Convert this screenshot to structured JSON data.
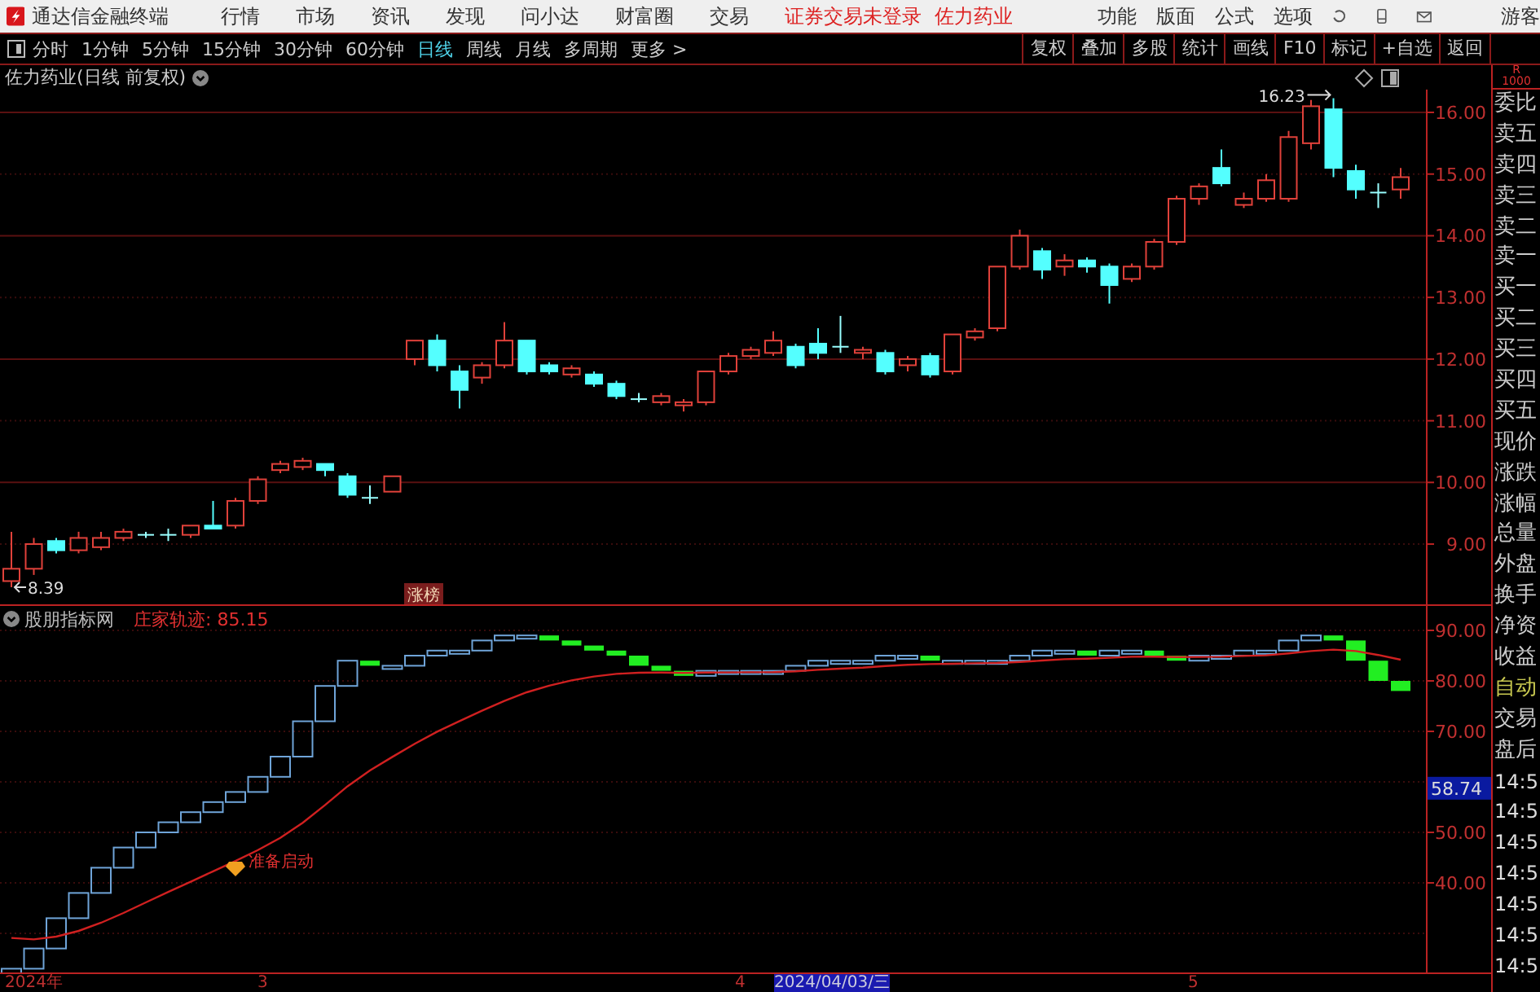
{
  "menubar": {
    "app_title": "通达信金融终端",
    "menus": [
      "行情",
      "市场",
      "资讯",
      "发现",
      "问小达",
      "财富圈",
      "交易"
    ],
    "login_status": "证券交易未登录",
    "stock_name": "佐力药业",
    "tools": [
      "功能",
      "版面",
      "公式",
      "选项"
    ],
    "user": "游客"
  },
  "toolbar": {
    "periods": [
      {
        "label": "分时",
        "selected": false
      },
      {
        "label": "1分钟",
        "selected": false
      },
      {
        "label": "5分钟",
        "selected": false
      },
      {
        "label": "15分钟",
        "selected": false
      },
      {
        "label": "30分钟",
        "selected": false
      },
      {
        "label": "60分钟",
        "selected": false
      },
      {
        "label": "日线",
        "selected": true
      },
      {
        "label": "周线",
        "selected": false
      },
      {
        "label": "月线",
        "selected": false
      },
      {
        "label": "多周期",
        "selected": false
      },
      {
        "label": "更多 >",
        "selected": false
      }
    ],
    "buttons": [
      "复权",
      "叠加",
      "多股",
      "统计",
      "画线",
      "F10",
      "标记",
      "+自选",
      "返回"
    ]
  },
  "price_chart": {
    "title": "佐力药业(日线 前复权)",
    "yticks": [
      "16.00",
      "15.00",
      "14.00",
      "13.00",
      "12.00",
      "11.00",
      "10.00",
      "9.00"
    ],
    "high_label": "16.23",
    "low_label": "8.39",
    "tag": "涨榜"
  },
  "indicator": {
    "source": "股朋指标网",
    "reading": "庄家轨迹: 85.15",
    "signal": "准备启动",
    "yticks": [
      "90.00",
      "80.00",
      "70.00",
      "50.00",
      "40.00"
    ],
    "cursor_value": "58.74"
  },
  "date_axis": [
    {
      "label": "2024年",
      "selected": false
    },
    {
      "label": "3",
      "selected": false
    },
    {
      "label": "4",
      "selected": false
    },
    {
      "label": "2024/04/03/三",
      "selected": true
    },
    {
      "label": "5",
      "selected": false
    }
  ],
  "quote_panel": {
    "header": [
      "R",
      "1000"
    ],
    "items": [
      {
        "text": "委比",
        "kind": "label"
      },
      {
        "text": "卖五",
        "kind": "label"
      },
      {
        "text": "卖四",
        "kind": "label"
      },
      {
        "text": "卖三",
        "kind": "label"
      },
      {
        "text": "卖二",
        "kind": "label"
      },
      {
        "text": "卖一",
        "kind": "label"
      },
      {
        "text": "买一",
        "kind": "label"
      },
      {
        "text": "买二",
        "kind": "label"
      },
      {
        "text": "买三",
        "kind": "label"
      },
      {
        "text": "买四",
        "kind": "label"
      },
      {
        "text": "买五",
        "kind": "label"
      },
      {
        "text": "现价",
        "kind": "label"
      },
      {
        "text": "涨跌",
        "kind": "label"
      },
      {
        "text": "涨幅",
        "kind": "label"
      },
      {
        "text": "总量",
        "kind": "label"
      },
      {
        "text": "外盘",
        "kind": "label"
      },
      {
        "text": "换手",
        "kind": "label"
      },
      {
        "text": "净资",
        "kind": "label"
      },
      {
        "text": "收益",
        "kind": "label"
      },
      {
        "text": "自动",
        "kind": "mode"
      },
      {
        "text": "交易",
        "kind": "label"
      },
      {
        "text": "盘后",
        "kind": "label"
      },
      {
        "text": "14:5",
        "kind": "time"
      },
      {
        "text": "14:5",
        "kind": "time"
      },
      {
        "text": "14:5",
        "kind": "time"
      },
      {
        "text": "14:5",
        "kind": "time"
      },
      {
        "text": "14:5",
        "kind": "time"
      },
      {
        "text": "14:5",
        "kind": "time"
      },
      {
        "text": "14:5",
        "kind": "time"
      }
    ]
  }
}
